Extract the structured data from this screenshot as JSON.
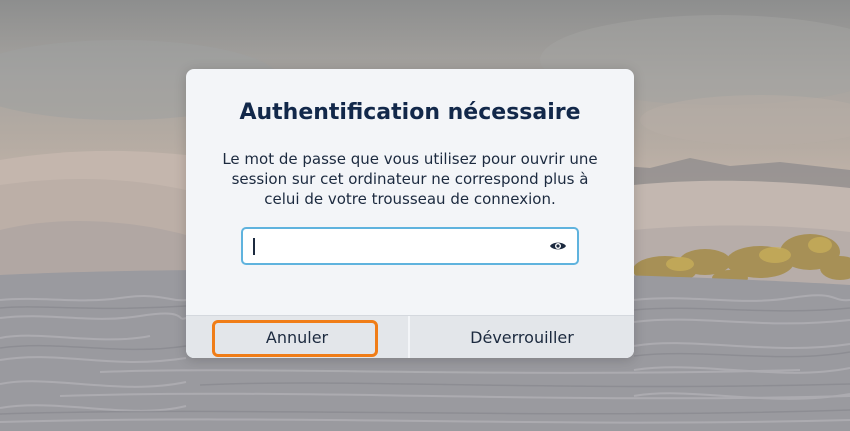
{
  "dialog": {
    "title": "Authentification nécessaire",
    "message_lines": [
      "Le mot de passe que vous utilisez pour ouvrir une",
      "session sur cet ordinateur ne correspond plus à",
      "celui de votre trousseau de connexion."
    ],
    "password_field": {
      "value": "",
      "placeholder": ""
    },
    "buttons": {
      "cancel_label": "Annuler",
      "unlock_label": "Déverrouiller"
    },
    "focused_button": "cancel"
  },
  "icons": {
    "reveal_password": "eye-icon"
  },
  "colors": {
    "dialog_background": "#f3f5f8",
    "title": "#12284a",
    "field_border": "#5fb3de",
    "focus_ring": "#f07d17",
    "button_bar": "#e3e6ea"
  }
}
